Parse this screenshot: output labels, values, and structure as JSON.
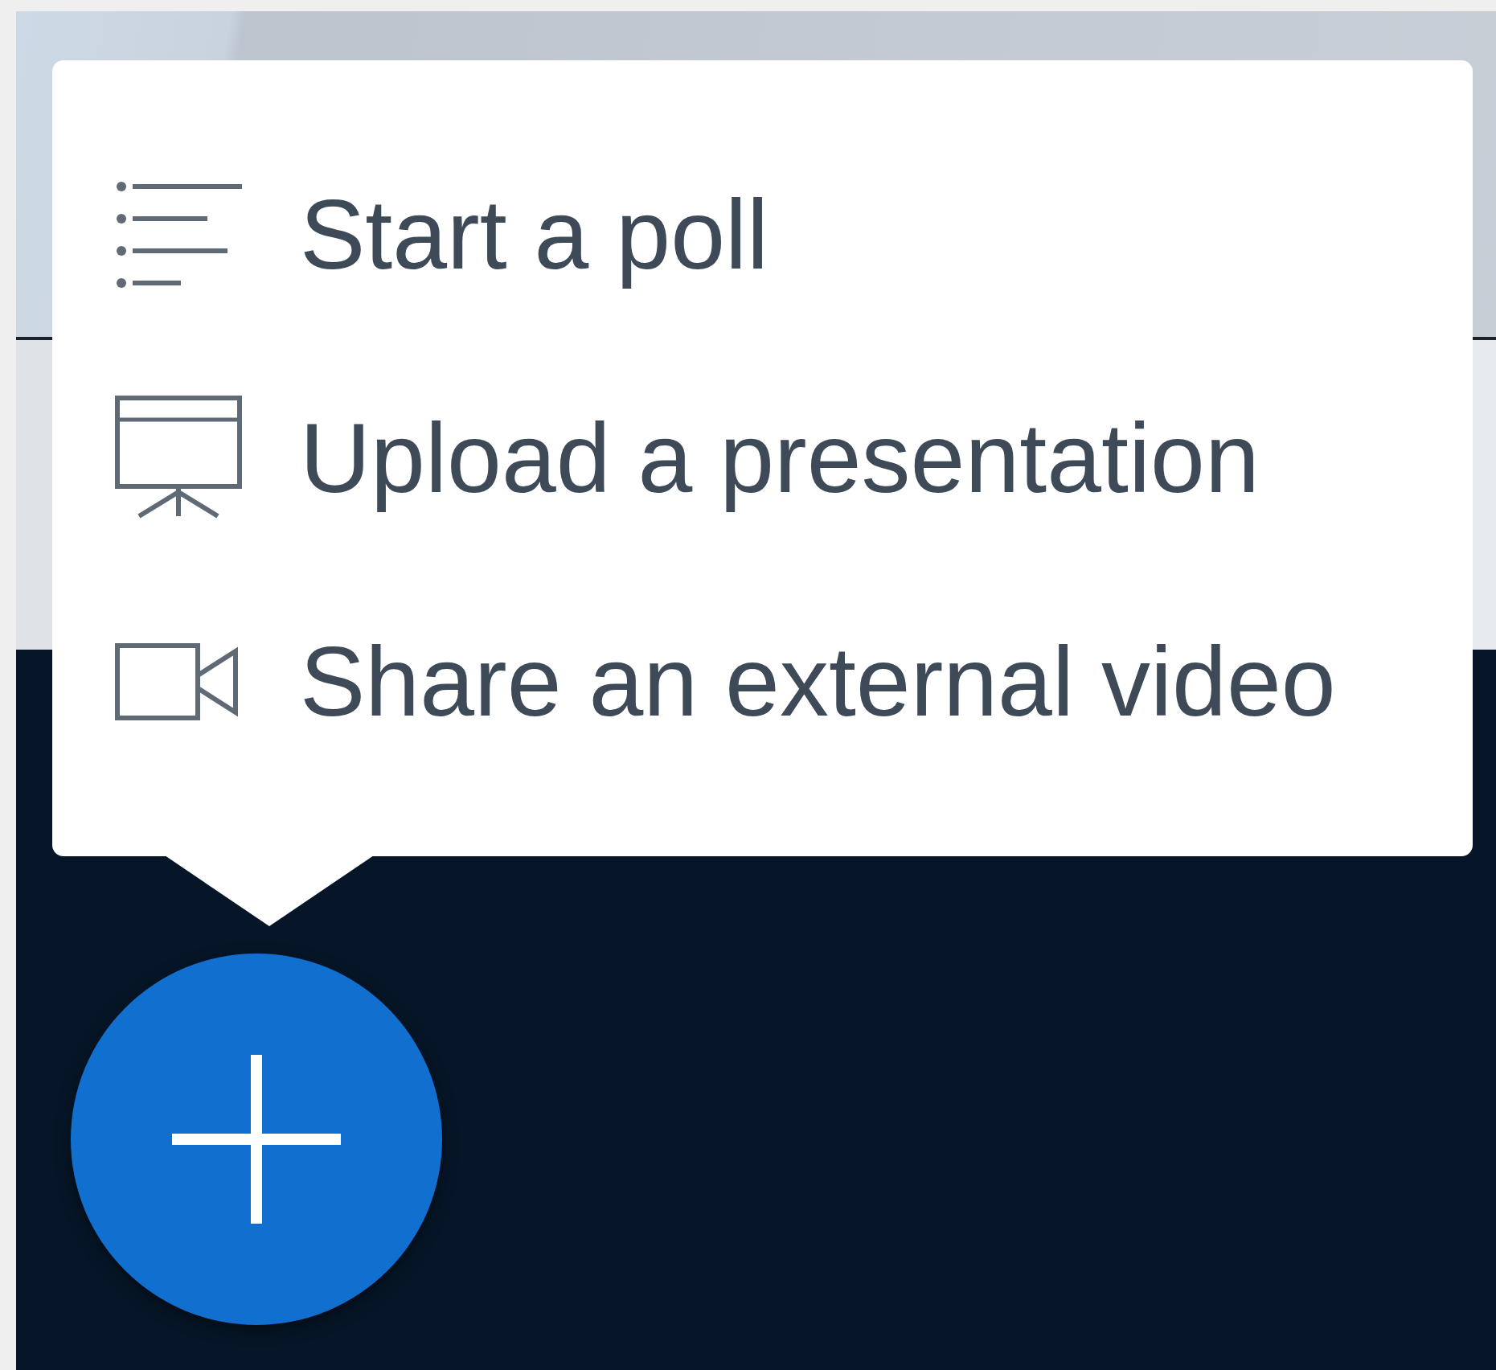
{
  "actions_menu": {
    "items": [
      {
        "kind": "poll",
        "label": "Start a poll"
      },
      {
        "kind": "presentation",
        "label": "Upload a presentation"
      },
      {
        "kind": "video",
        "label": "Share an external video"
      }
    ]
  }
}
